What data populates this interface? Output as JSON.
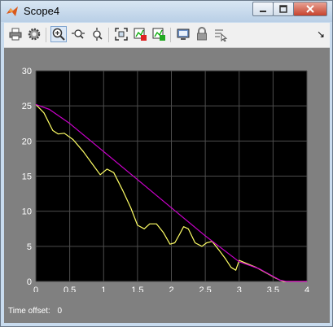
{
  "window": {
    "title": "Scope4"
  },
  "toolbar": {
    "overflow_glyph": "↘"
  },
  "plot": {
    "time_offset_label": "Time offset:",
    "time_offset_value": "0",
    "axis_color": "#000000",
    "grid_color": "#4d4d4d",
    "tick_label_color": "#ffffff"
  },
  "chart_data": {
    "type": "line",
    "title": "",
    "xlabel": "",
    "ylabel": "",
    "xlim": [
      0,
      4
    ],
    "ylim": [
      0,
      30
    ],
    "x_ticks": [
      "0",
      "0.5",
      "1",
      "1.5",
      "2",
      "2.5",
      "3",
      "3.5",
      "4"
    ],
    "y_ticks": [
      "0",
      "5",
      "10",
      "15",
      "20",
      "25",
      "30"
    ],
    "grid": true,
    "series": [
      {
        "color": "#ffff66",
        "x": [
          0,
          0.12,
          0.25,
          0.33,
          0.42,
          0.55,
          0.7,
          0.85,
          0.95,
          1.05,
          1.15,
          1.28,
          1.4,
          1.5,
          1.6,
          1.68,
          1.78,
          1.88,
          1.98,
          2.05,
          2.12,
          2.18,
          2.25,
          2.35,
          2.45,
          2.52,
          2.6,
          2.7,
          2.8,
          2.88,
          2.95,
          3.0,
          3.1,
          3.25,
          3.4,
          3.55,
          3.65,
          3.7,
          4.0
        ],
        "y": [
          25.2,
          24,
          21.5,
          21,
          21.1,
          20.2,
          18.5,
          16.5,
          15.2,
          16,
          15.5,
          13,
          10.5,
          8,
          7.5,
          8.2,
          8.2,
          7,
          5.3,
          5.5,
          6.7,
          7.8,
          7.5,
          5.5,
          5,
          5.5,
          5.7,
          4.5,
          3.2,
          2,
          1.6,
          3,
          2.6,
          2,
          1.2,
          0.4,
          0,
          0,
          0
        ]
      },
      {
        "color": "#cc00cc",
        "x": [
          0,
          0.2,
          0.5,
          1.0,
          1.5,
          2.0,
          2.5,
          3.0,
          3.3,
          3.6,
          3.7,
          4.0
        ],
        "y": [
          25.2,
          24.5,
          22.5,
          18.5,
          14.5,
          10.5,
          6.5,
          2.8,
          1.8,
          0.2,
          0,
          0
        ]
      }
    ]
  }
}
